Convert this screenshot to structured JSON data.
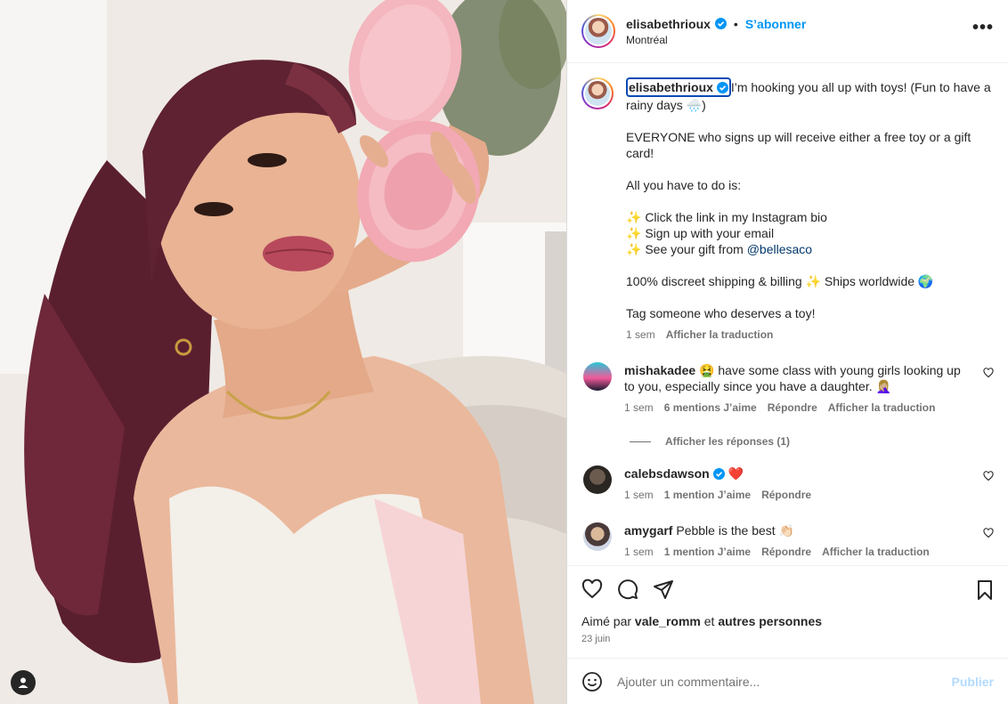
{
  "post": {
    "author": "elisabethrioux",
    "follow_label": "S’abonner",
    "location": "Montréal",
    "more_label": "•••"
  },
  "caption": {
    "author": "elisabethrioux",
    "lines": [
      "I’m hooking you all up with toys! (Fun to have a rainy days 🌧️)",
      "EVERYONE who signs up will receive either a free toy or a gift card!",
      "All you have to do is:"
    ],
    "steps": [
      "✨ Click the link in my Instagram bio",
      "✨ Sign up with your email",
      "✨ See your gift from "
    ],
    "mention": "@bellesaco",
    "shipping": "100% discreet shipping & billing ✨ Ships worldwide 🌍",
    "tag_line": "Tag someone who deserves a toy!",
    "time": "1 sem",
    "translate": "Afficher la traduction"
  },
  "comments": [
    {
      "user": "mishakadee",
      "text": "🤮 have some class with young girls looking up to you, especially since you have a daughter. 🤦🏼‍♀️",
      "time": "1 sem",
      "likes": "6 mentions J’aime",
      "reply": "Répondre",
      "translate": "Afficher la traduction",
      "view_replies": "Afficher les réponses (1)"
    },
    {
      "user": "calebsdawson",
      "text": "❤️",
      "time": "1 sem",
      "likes": "1 mention J’aime",
      "reply": "Répondre"
    },
    {
      "user": "amygarf",
      "text": "Pebble is the best 👏🏻",
      "time": "1 sem",
      "likes": "1 mention J’aime",
      "reply": "Répondre",
      "translate": "Afficher la traduction"
    }
  ],
  "likes": {
    "prefix": "Aimé par",
    "user": "vale_romm",
    "and": "et",
    "others": "autres personnes"
  },
  "date": "23 juin",
  "comment_input": {
    "placeholder": "Ajouter un commentaire...",
    "publish": "Publier"
  },
  "colors": {
    "accent": "#0095f6",
    "publish_disabled": "#b3dbff",
    "secondary_text": "#737373"
  }
}
